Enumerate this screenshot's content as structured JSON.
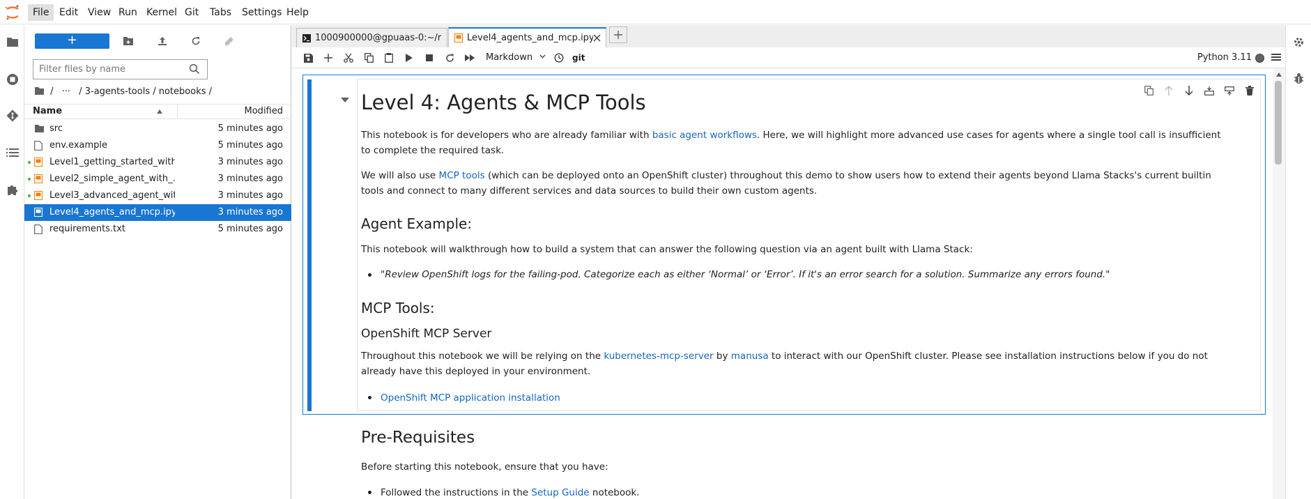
{
  "menu": [
    "File",
    "Edit",
    "View",
    "Run",
    "Kernel",
    "Git",
    "Tabs",
    "Settings",
    "Help"
  ],
  "filebrowser": {
    "new_label": "+",
    "filter_placeholder": "Filter files by name",
    "breadcrumb": {
      "root": "/",
      "ellipsis": "···",
      "path": "/ 3-agents-tools / notebooks /"
    },
    "columns": {
      "name": "Name",
      "modified": "Modified"
    },
    "files": [
      {
        "name": "src",
        "modified": "5 minutes ago",
        "type": "folder",
        "running": false,
        "selected": false
      },
      {
        "name": "env.example",
        "modified": "5 minutes ago",
        "type": "file",
        "running": false,
        "selected": false
      },
      {
        "name": "Level1_getting_started_with...",
        "modified": "3 minutes ago",
        "type": "notebook",
        "running": true,
        "selected": false
      },
      {
        "name": "Level2_simple_agent_with_...",
        "modified": "3 minutes ago",
        "type": "notebook",
        "running": true,
        "selected": false
      },
      {
        "name": "Level3_advanced_agent_wit...",
        "modified": "3 minutes ago",
        "type": "notebook",
        "running": true,
        "selected": false
      },
      {
        "name": "Level4_agents_and_mcp.ipynb",
        "modified": "3 minutes ago",
        "type": "notebook",
        "running": false,
        "selected": true
      },
      {
        "name": "requirements.txt",
        "modified": "5 minutes ago",
        "type": "file",
        "running": false,
        "selected": false
      }
    ]
  },
  "tabs": [
    {
      "label": "1000900000@gpuaas-0:~/r",
      "icon": "terminal-icon",
      "active": false
    },
    {
      "label": "Level4_agents_and_mcp.ipy",
      "icon": "notebook-icon",
      "active": true
    }
  ],
  "toolbar": {
    "cell_type": "Markdown",
    "git": "git",
    "kernel": "Python 3.11"
  },
  "cell": {
    "h1": "Level 4: Agents & MCP Tools",
    "p1": {
      "a": "This notebook is for developers who are already familiar with ",
      "link": "basic agent workflows",
      "b": ". Here, we will highlight more advanced use cases for agents where a single tool call is insufficient to complete the required task."
    },
    "p2": {
      "a": "We will also use ",
      "link": "MCP tools",
      "b": " (which can be deployed onto an OpenShift cluster) throughout this demo to show users how to extend their agents beyond Llama Stacks's current builtin tools and connect to many different services and data sources to build their own custom agents."
    },
    "h2_example": "Agent Example:",
    "p3": "This notebook will walkthrough how to build a system that can answer the following question via an agent built with Llama Stack:",
    "quote": "\"Review OpenShift logs for the failing-pod. Categorize each as either ‘Normal’ or ‘Error’. If it's an error search for a solution. Summarize any errors found.\"",
    "h2_mcp": "MCP Tools:",
    "h3_server": "OpenShift MCP Server",
    "p4": {
      "a": "Throughout this notebook we will be relying on the ",
      "link1": "kubernetes-mcp-server",
      "b": " by ",
      "link2": "manusa",
      "c": " to interact with our OpenShift cluster. Please see installation instructions below if you do not already have this deployed in your environment."
    },
    "install_link": "OpenShift MCP application installation"
  },
  "below": {
    "h2": "Pre-Requisites",
    "p": "Before starting this notebook, ensure that you have:",
    "li": {
      "a": "Followed the instructions in the ",
      "link": "Setup Guide",
      "b": " notebook."
    }
  },
  "colors": {
    "accent": "#1976d2",
    "link": "#1565c0",
    "notebook_orange": "#f57c00"
  }
}
